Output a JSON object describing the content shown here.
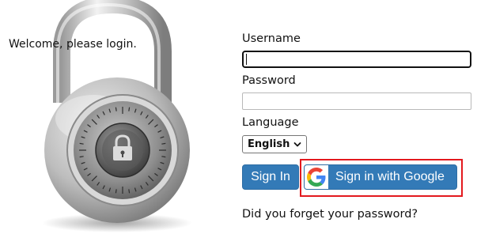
{
  "welcome_text": "Welcome, please login.",
  "form": {
    "username_label": "Username",
    "username_value": "",
    "password_label": "Password",
    "password_value": "",
    "language_label": "Language",
    "language_selected": "English"
  },
  "buttons": {
    "sign_in": "Sign In",
    "google_sign_in": "Sign in with Google"
  },
  "forgot_password_link": "Did you forget your password?",
  "colors": {
    "button_blue": "#337ab7",
    "highlight_red": "#e3191e"
  },
  "icons": {
    "padlock": "combination-padlock-icon",
    "google": "google-g-icon",
    "dropdown": "chevron-down-icon"
  }
}
